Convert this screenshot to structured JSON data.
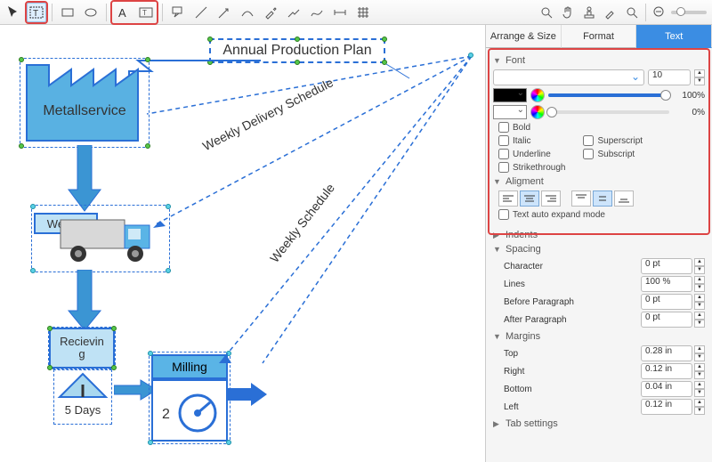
{
  "toolbar": {
    "tools": [
      "pointer",
      "text-frame",
      "rect",
      "ellipse",
      "text",
      "text-box",
      "callout",
      "line",
      "arrow",
      "curve",
      "eyedropper",
      "connector",
      "freehand",
      "dimension",
      "grid"
    ],
    "right_tools": [
      "zoom-view",
      "hand",
      "stamp",
      "eyedropper2",
      "search"
    ]
  },
  "inspector": {
    "tabs": [
      "Arrange & Size",
      "Format",
      "Text"
    ],
    "active_tab": 2,
    "font": {
      "section_label": "Font",
      "family": "",
      "size": "10",
      "fg_opacity": "100%",
      "bg_opacity": "0%",
      "styles": {
        "bold": "Bold",
        "italic": "Italic",
        "underline": "Underline",
        "strike": "Strikethrough",
        "superscript": "Superscript",
        "subscript": "Subscript"
      },
      "alignment_label": "Aligment",
      "expand_label": "Text auto expand mode"
    },
    "indents_label": "Indents",
    "spacing": {
      "label": "Spacing",
      "character_label": "Character",
      "character": "0 pt",
      "lines_label": "Lines",
      "lines": "100 %",
      "before_label": "Before Paragraph",
      "before": "0 pt",
      "after_label": "After Paragraph",
      "after": "0 pt"
    },
    "margins": {
      "label": "Margins",
      "top_label": "Top",
      "top": "0.28 in",
      "right_label": "Right",
      "right": "0.12 in",
      "bottom_label": "Bottom",
      "bottom": "0.04 in",
      "left_label": "Left",
      "left": "0.12 in"
    },
    "tab_settings_label": "Tab settings"
  },
  "canvas": {
    "title_box": "Annual Production Plan",
    "factory": "Metallservice",
    "weekly_box": "Weekly",
    "recv_box": "Recievin\ng",
    "days_label": "5 Days",
    "milling": "Milling",
    "milling_num": "2",
    "diag1": "Weekly Delivery Schedule",
    "diag2": "Weekly Schedule"
  }
}
